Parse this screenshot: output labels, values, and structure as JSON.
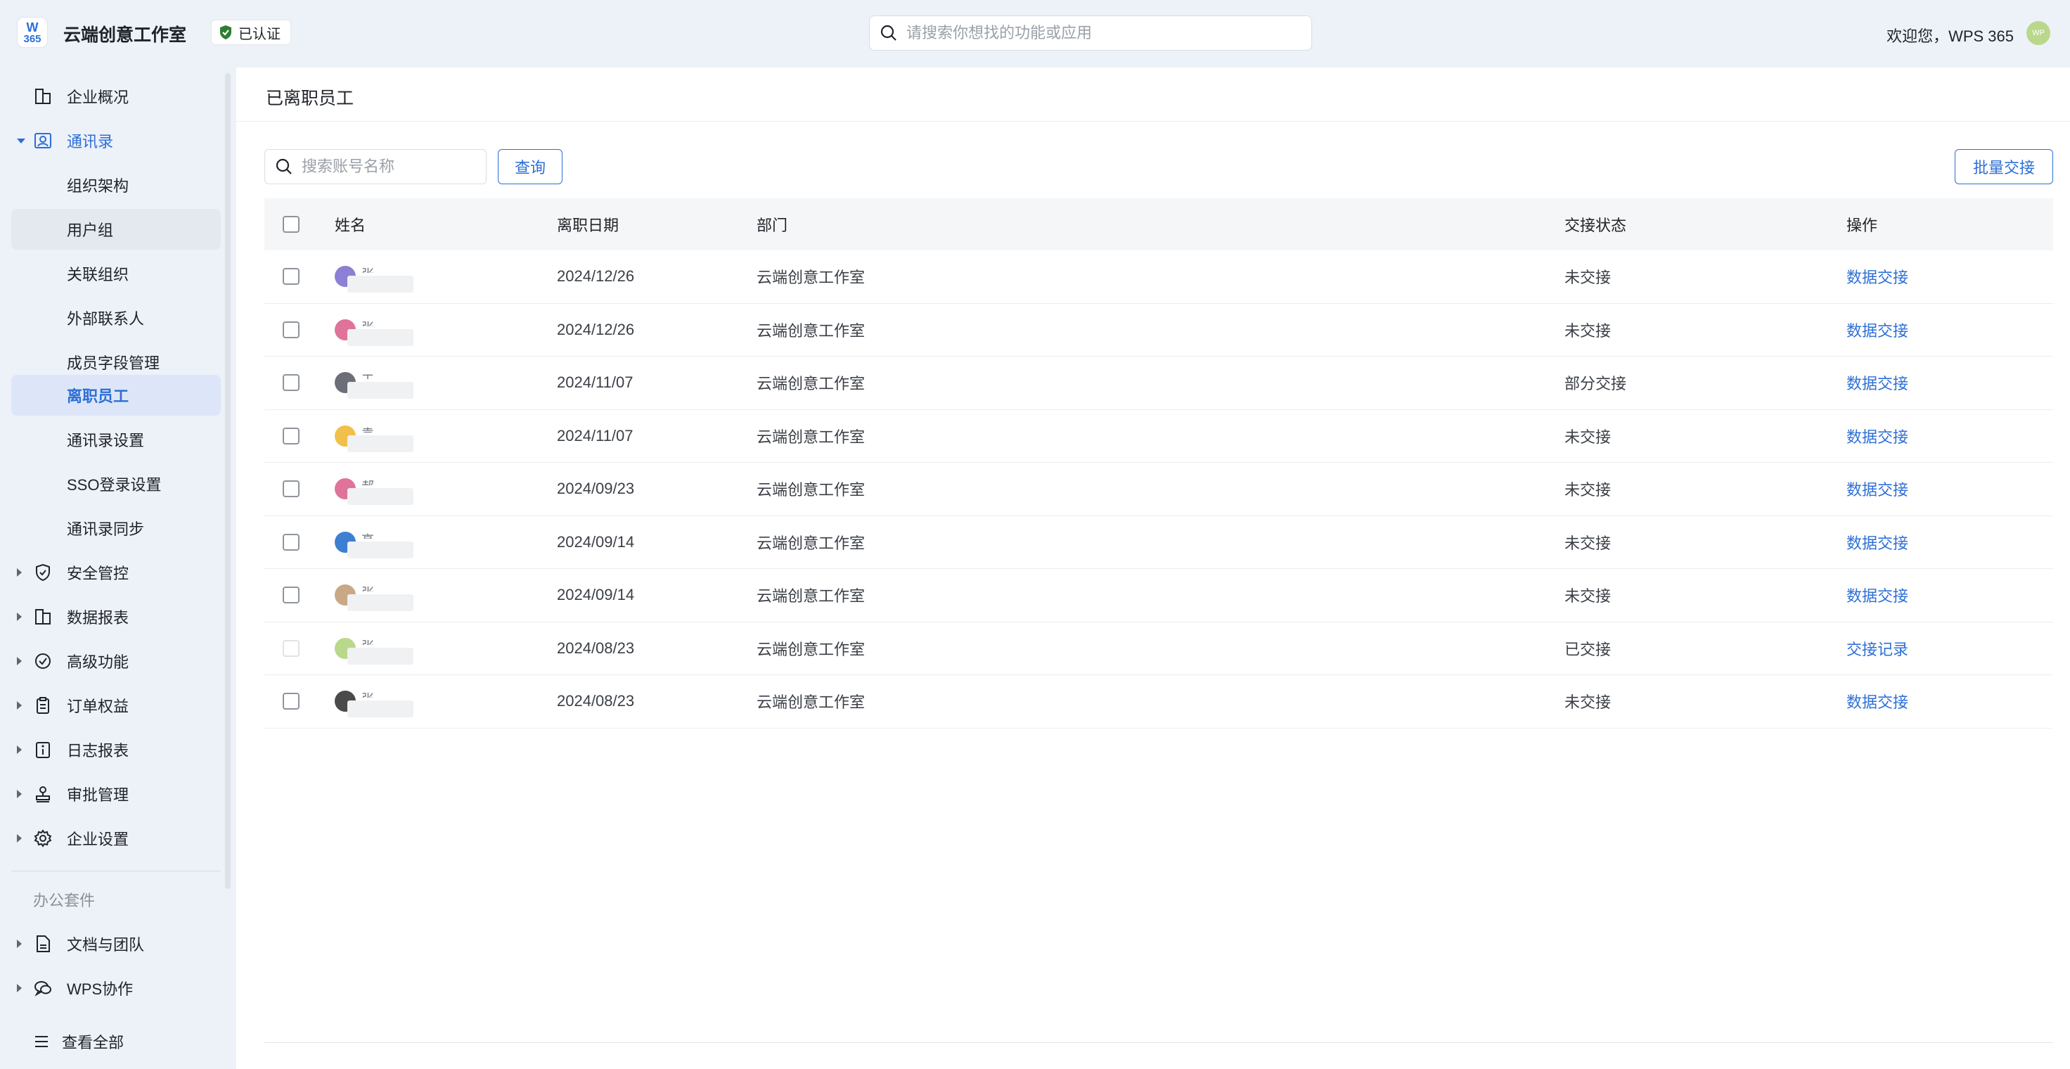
{
  "header": {
    "app_title": "云端创意工作室",
    "verified_badge": "已认证",
    "search_placeholder": "请搜索你想找的功能或应用",
    "welcome": "欢迎您，WPS 365",
    "logo_top": "W",
    "logo_bottom": "365",
    "avatar_text": "WP"
  },
  "sidebar": {
    "items": [
      {
        "label": "企业概况",
        "icon": "building-icon"
      },
      {
        "label": "通讯录",
        "icon": "contacts-icon"
      },
      {
        "label": "组织架构"
      },
      {
        "label": "用户组"
      },
      {
        "label": "关联组织"
      },
      {
        "label": "外部联系人"
      },
      {
        "label": "成员字段管理"
      },
      {
        "label": "离职员工"
      },
      {
        "label": "通讯录设置"
      },
      {
        "label": "SSO登录设置"
      },
      {
        "label": "通讯录同步"
      },
      {
        "label": "安全管控",
        "icon": "shield-icon"
      },
      {
        "label": "数据报表",
        "icon": "report-icon"
      },
      {
        "label": "高级功能",
        "icon": "badge-icon"
      },
      {
        "label": "订单权益",
        "icon": "clipboard-icon"
      },
      {
        "label": "日志报表",
        "icon": "info-doc-icon"
      },
      {
        "label": "审批管理",
        "icon": "stamp-icon"
      },
      {
        "label": "企业设置",
        "icon": "gear-icon"
      }
    ],
    "office_group_title": "办公套件",
    "office_items": [
      {
        "label": "文档与团队",
        "icon": "document-icon"
      },
      {
        "label": "WPS协作",
        "icon": "chat-icon"
      }
    ],
    "view_all": "查看全部"
  },
  "main": {
    "page_title": "已离职员工",
    "search_placeholder": "搜索账号名称",
    "query_button": "查询",
    "batch_button": "批量交接",
    "columns": [
      "姓名",
      "离职日期",
      "部门",
      "交接状态",
      "操作"
    ],
    "rows": [
      {
        "name": "张组",
        "avatar_color": "#8c7fd6",
        "date": "2024/12/26",
        "dept": "云端创意工作室",
        "status": "未交接",
        "action": "数据交接",
        "selectable": true
      },
      {
        "name": "张组",
        "avatar_color": "#e0739a",
        "date": "2024/12/26",
        "dept": "云端创意工作室",
        "status": "未交接",
        "action": "数据交接",
        "selectable": true
      },
      {
        "name": "王芸",
        "avatar_color": "#6c6f78",
        "date": "2024/11/07",
        "dept": "云端创意工作室",
        "status": "部分交接",
        "action": "数据交接",
        "selectable": true
      },
      {
        "name": "袁长",
        "avatar_color": "#f0c04a",
        "date": "2024/11/07",
        "dept": "云端创意工作室",
        "status": "未交接",
        "action": "数据交接",
        "selectable": true
      },
      {
        "name": "郝春鑫",
        "avatar_color": "#e0739a",
        "date": "2024/09/23",
        "dept": "云端创意工作室",
        "status": "未交接",
        "action": "数据交接",
        "selectable": true
      },
      {
        "name": "高诗栩",
        "avatar_color": "#3d7fd1",
        "date": "2024/09/14",
        "dept": "云端创意工作室",
        "status": "未交接",
        "action": "数据交接",
        "selectable": true
      },
      {
        "name": "张小小",
        "avatar_color": "#c9a887",
        "date": "2024/09/14",
        "dept": "云端创意工作室",
        "status": "未交接",
        "action": "数据交接",
        "selectable": true
      },
      {
        "name": "张组",
        "avatar_color": "#b9d88b",
        "date": "2024/08/23",
        "dept": "云端创意工作室",
        "status": "已交接",
        "action": "交接记录",
        "selectable": false
      },
      {
        "name": "张组",
        "avatar_color": "#4a4a4a",
        "date": "2024/08/23",
        "dept": "云端创意工作室",
        "status": "未交接",
        "action": "数据交接",
        "selectable": true
      }
    ]
  },
  "colors": {
    "accent": "#2d6fd6",
    "sidebar_bg": "#edf1f8",
    "active_bg": "#dde6f8",
    "verified_green": "#2e7d32"
  }
}
